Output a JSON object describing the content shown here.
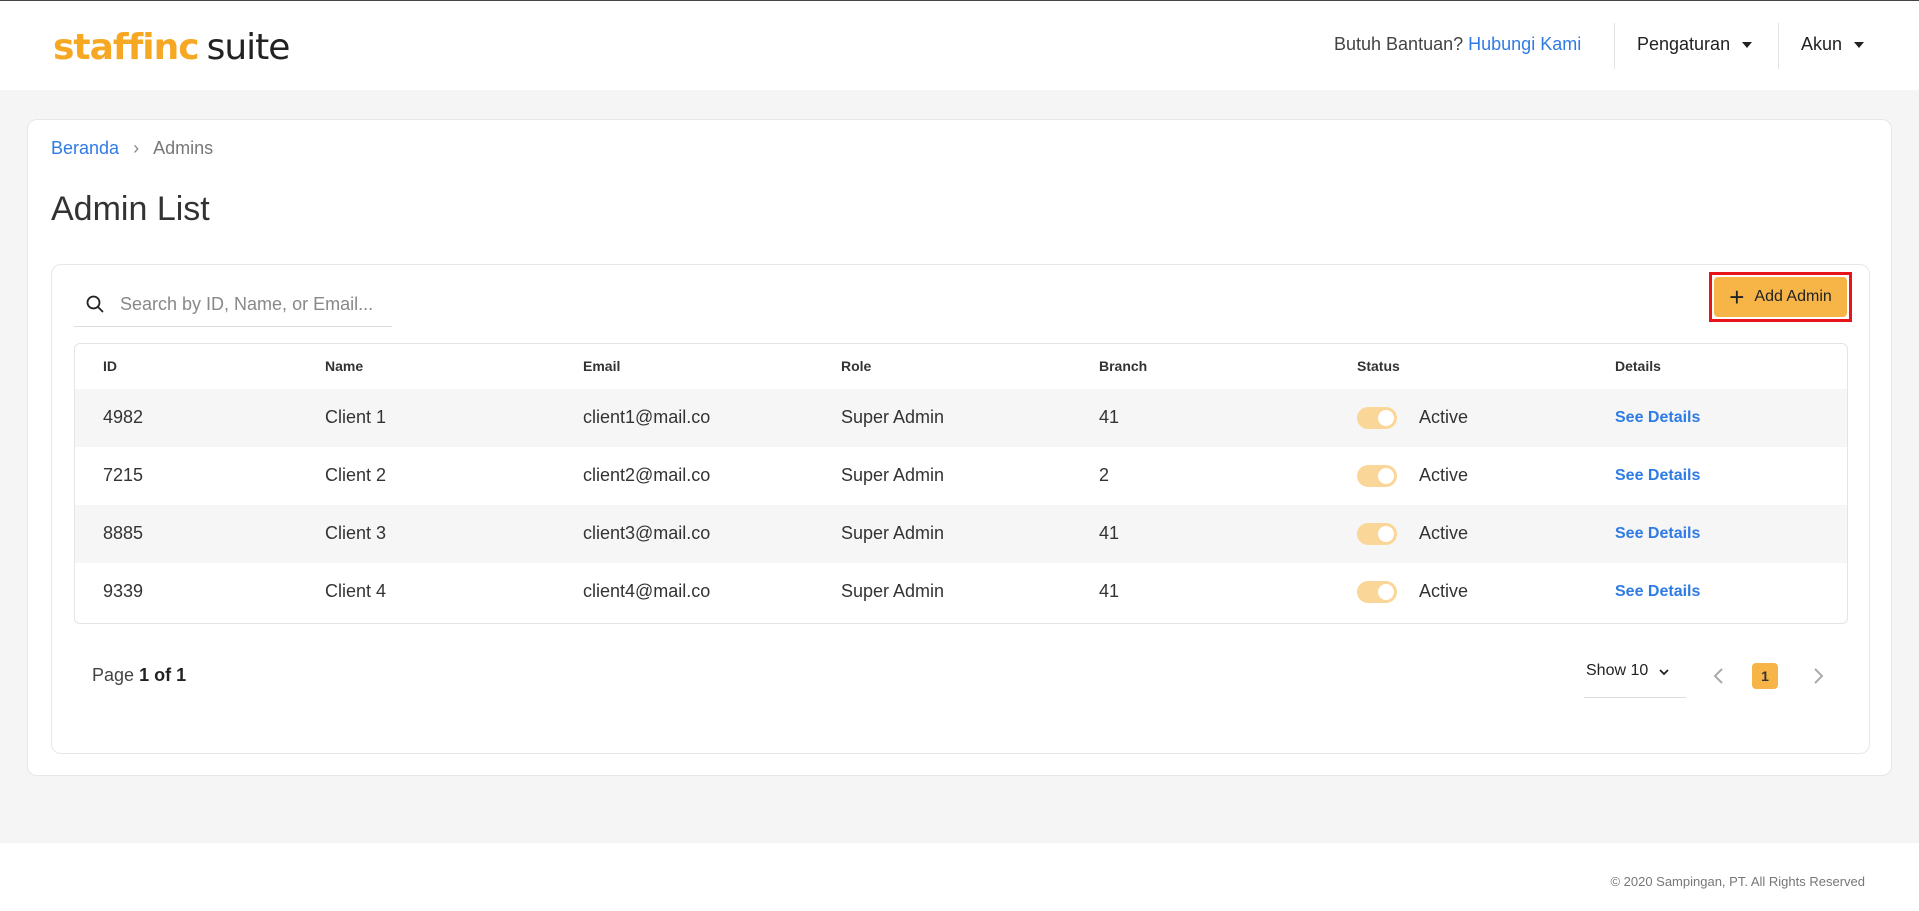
{
  "header": {
    "logo_brand": "staffinc",
    "logo_suffix": "suite",
    "help_text": "Butuh Bantuan?",
    "help_link": "Hubungi Kami",
    "settings_menu": "Pengaturan",
    "account_menu": "Akun"
  },
  "breadcrumb": {
    "home": "Beranda",
    "separator": "›",
    "current": "Admins"
  },
  "page_title": "Admin List",
  "search": {
    "placeholder": "Search by ID, Name, or Email..."
  },
  "add_button_label": "Add Admin",
  "table": {
    "columns": [
      "ID",
      "Name",
      "Email",
      "Role",
      "Branch",
      "Status",
      "Details"
    ],
    "rows": [
      {
        "id": "4982",
        "name": "Client 1",
        "email": "client1@mail.co",
        "role": "Super Admin",
        "branch": "41",
        "status": "Active",
        "details": "See Details"
      },
      {
        "id": "7215",
        "name": "Client 2",
        "email": "client2@mail.co",
        "role": "Super Admin",
        "branch": "2",
        "status": "Active",
        "details": "See Details"
      },
      {
        "id": "8885",
        "name": "Client 3",
        "email": "client3@mail.co",
        "role": "Super Admin",
        "branch": "41",
        "status": "Active",
        "details": "See Details"
      },
      {
        "id": "9339",
        "name": "Client 4",
        "email": "client4@mail.co",
        "role": "Super Admin",
        "branch": "41",
        "status": "Active",
        "details": "See Details"
      }
    ]
  },
  "pagination": {
    "page_word": "Page",
    "page_of": "1 of 1",
    "show_label": "Show 10",
    "current_page": "1"
  },
  "footer": {
    "copyright": "© 2020 Sampingan, PT. All Rights Reserved"
  },
  "colors": {
    "accent": "#f7b548",
    "link": "#2f7be5",
    "highlight_border": "#e8141c"
  }
}
